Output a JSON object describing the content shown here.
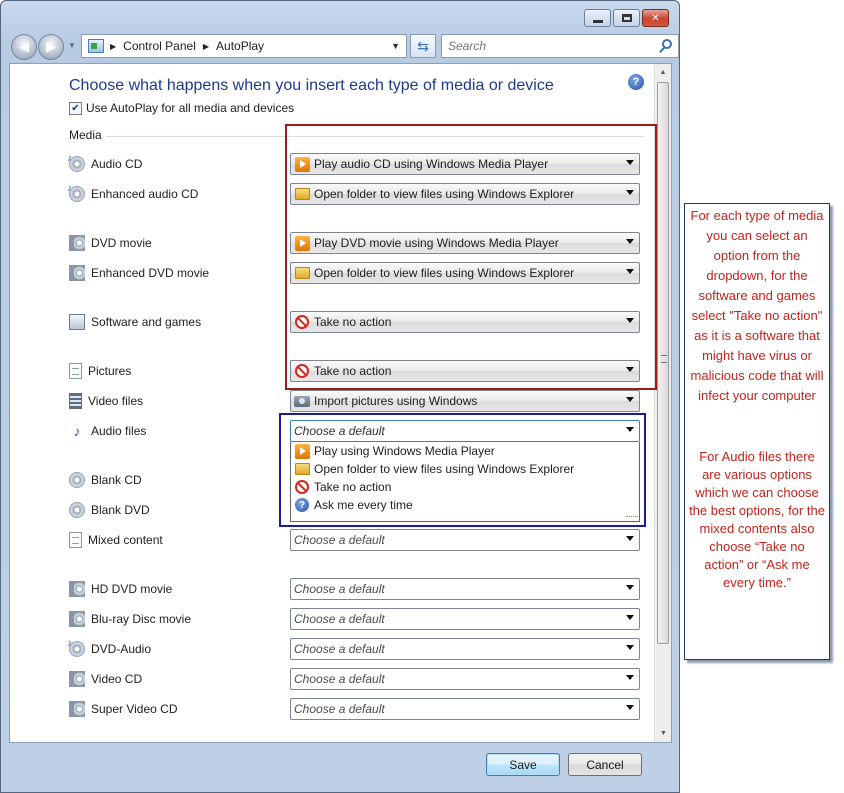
{
  "window": {
    "address": [
      "Control Panel",
      "AutoPlay"
    ],
    "search_placeholder": "Search"
  },
  "page": {
    "heading": "Choose what happens when you insert each type of media or device",
    "use_autoplay_label": "Use AutoPlay for all media and devices",
    "use_autoplay_checked": true,
    "section_media": "Media"
  },
  "rows": [
    {
      "label": "Audio CD",
      "icon": "audio-cd-icon",
      "value": "Play audio CD using Windows Media Player",
      "value_icon": "media-player-icon"
    },
    {
      "label": "Enhanced audio CD",
      "icon": "audio-cd-icon",
      "value": "Open folder to view files using Windows Explorer",
      "value_icon": "folder-icon"
    },
    {
      "label": "DVD movie",
      "icon": "dvd-icon",
      "value": "Play DVD movie using Windows Media Player",
      "value_icon": "media-player-icon"
    },
    {
      "label": "Enhanced DVD movie",
      "icon": "dvd-icon",
      "value": "Open folder to view files using Windows Explorer",
      "value_icon": "folder-icon"
    },
    {
      "label": "Software and games",
      "icon": "software-icon",
      "value": "Take no action",
      "value_icon": "no-action-icon"
    },
    {
      "label": "Pictures",
      "icon": "pictures-icon",
      "value": "Take no action",
      "value_icon": "no-action-icon"
    },
    {
      "label": "Video files",
      "icon": "video-files-icon",
      "value": "Import pictures using Windows",
      "value_icon": "camera-icon"
    },
    {
      "label": "Audio files",
      "icon": "audio-files-icon",
      "value": "Choose a default",
      "value_icon": ""
    },
    {
      "label": "Blank CD",
      "icon": "blank-cd-icon",
      "value": "",
      "value_icon": ""
    },
    {
      "label": "Blank DVD",
      "icon": "blank-dvd-icon",
      "value": "",
      "value_icon": ""
    },
    {
      "label": "Mixed content",
      "icon": "mixed-content-icon",
      "value": "Choose a default",
      "value_icon": ""
    },
    {
      "label": "HD DVD movie",
      "icon": "dvd-icon",
      "value": "Choose a default",
      "value_icon": ""
    },
    {
      "label": "Blu-ray Disc movie",
      "icon": "dvd-icon",
      "value": "Choose a default",
      "value_icon": ""
    },
    {
      "label": "DVD-Audio",
      "icon": "audio-cd-icon",
      "value": "Choose a default",
      "value_icon": ""
    },
    {
      "label": "Video CD",
      "icon": "dvd-icon",
      "value": "Choose a default",
      "value_icon": ""
    },
    {
      "label": "Super Video CD",
      "icon": "dvd-icon",
      "value": "Choose a default",
      "value_icon": ""
    }
  ],
  "open_dropdown_options": [
    {
      "label": "Play using Windows Media Player",
      "icon": "media-player-icon"
    },
    {
      "label": "Open folder to view files using Windows Explorer",
      "icon": "folder-icon"
    },
    {
      "label": "Take no action",
      "icon": "no-action-icon"
    },
    {
      "label": "Ask me every time",
      "icon": "question-icon"
    }
  ],
  "buttons": {
    "save": "Save",
    "cancel": "Cancel"
  },
  "annotation": {
    "text1": "For each type of media you can select an option from the dropdown, for the software and games select \"Take no action\" as it is a software that might have virus or malicious code that will infect your computer",
    "text2": "For Audio files there are various options which we can choose the best options, for the mixed contents also choose “Take no action” or “Ask me every time.”"
  },
  "colors": {
    "heading": "#1e3a8a",
    "annotation_text": "#c0241a",
    "red_frame": "#a11919",
    "blue_frame": "#1a1a9a"
  }
}
